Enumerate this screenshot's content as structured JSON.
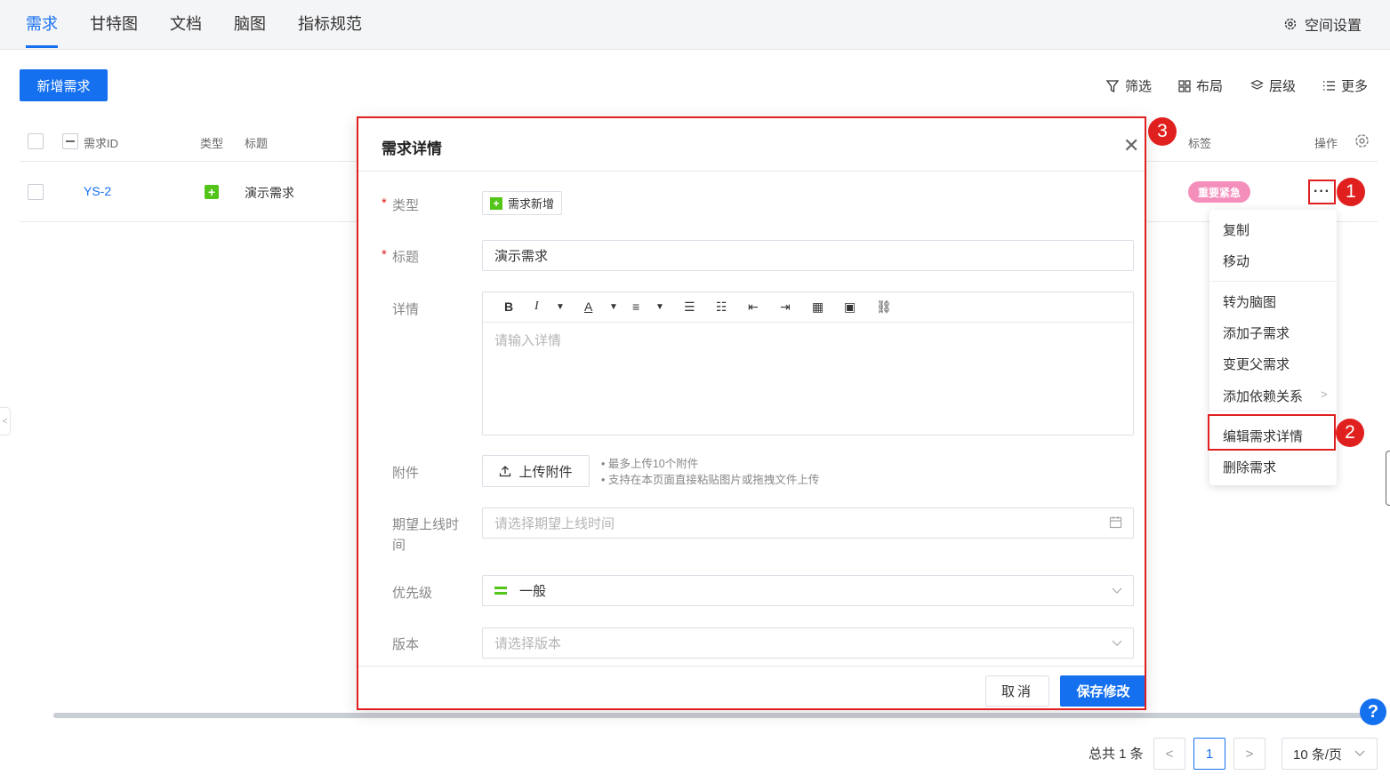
{
  "nav": {
    "tabs": [
      "需求",
      "甘特图",
      "文档",
      "脑图",
      "指标规范"
    ],
    "space_settings": "空间设置"
  },
  "toolbar": {
    "new_button": "新增需求",
    "filter": "筛选",
    "layout": "布局",
    "level": "层级",
    "more": "更多"
  },
  "table": {
    "headers": {
      "id": "需求ID",
      "type": "类型",
      "title": "标题",
      "tags": "标签",
      "actions": "操作"
    },
    "rows": [
      {
        "id": "YS-2",
        "title": "演示需求",
        "tag": "重要紧急",
        "tag_color": "#f48fbb"
      }
    ]
  },
  "context_menu": {
    "items": [
      "复制",
      "移动",
      "转为脑图",
      "添加子需求",
      "变更父需求",
      "添加依赖关系",
      "编辑需求详情",
      "删除需求"
    ]
  },
  "annotations": [
    "1",
    "2",
    "3"
  ],
  "modal": {
    "title": "需求详情",
    "fields": {
      "type_label": "类型",
      "type_value": "需求新增",
      "title_label": "标题",
      "title_value": "演示需求",
      "detail_label": "详情",
      "detail_placeholder": "请输入详情",
      "attach_label": "附件",
      "upload_button": "上传附件",
      "upload_hint_1": "• 最多上传10个附件",
      "upload_hint_2": "• 支持在本页面直接粘贴图片或拖拽文件上传",
      "date_label": "期望上线时间",
      "date_placeholder": "请选择期望上线时间",
      "priority_label": "优先级",
      "priority_value": "一般",
      "version_label": "版本",
      "version_placeholder": "请选择版本"
    },
    "cancel_button": "取消",
    "save_button": "保存修改"
  },
  "pagination": {
    "total": "总共 1 条",
    "current_page": "1",
    "page_size": "10 条/页"
  },
  "colors": {
    "accent": "#1570ef",
    "annotation_red": "#e02020",
    "type_green": "#52c41a"
  },
  "icons": [
    "gear-icon",
    "filter-icon",
    "grid-icon",
    "layers-icon",
    "list-icon",
    "more-dots-icon",
    "close-icon",
    "upload-icon",
    "calendar-icon",
    "chevron-down-icon",
    "help-icon"
  ]
}
